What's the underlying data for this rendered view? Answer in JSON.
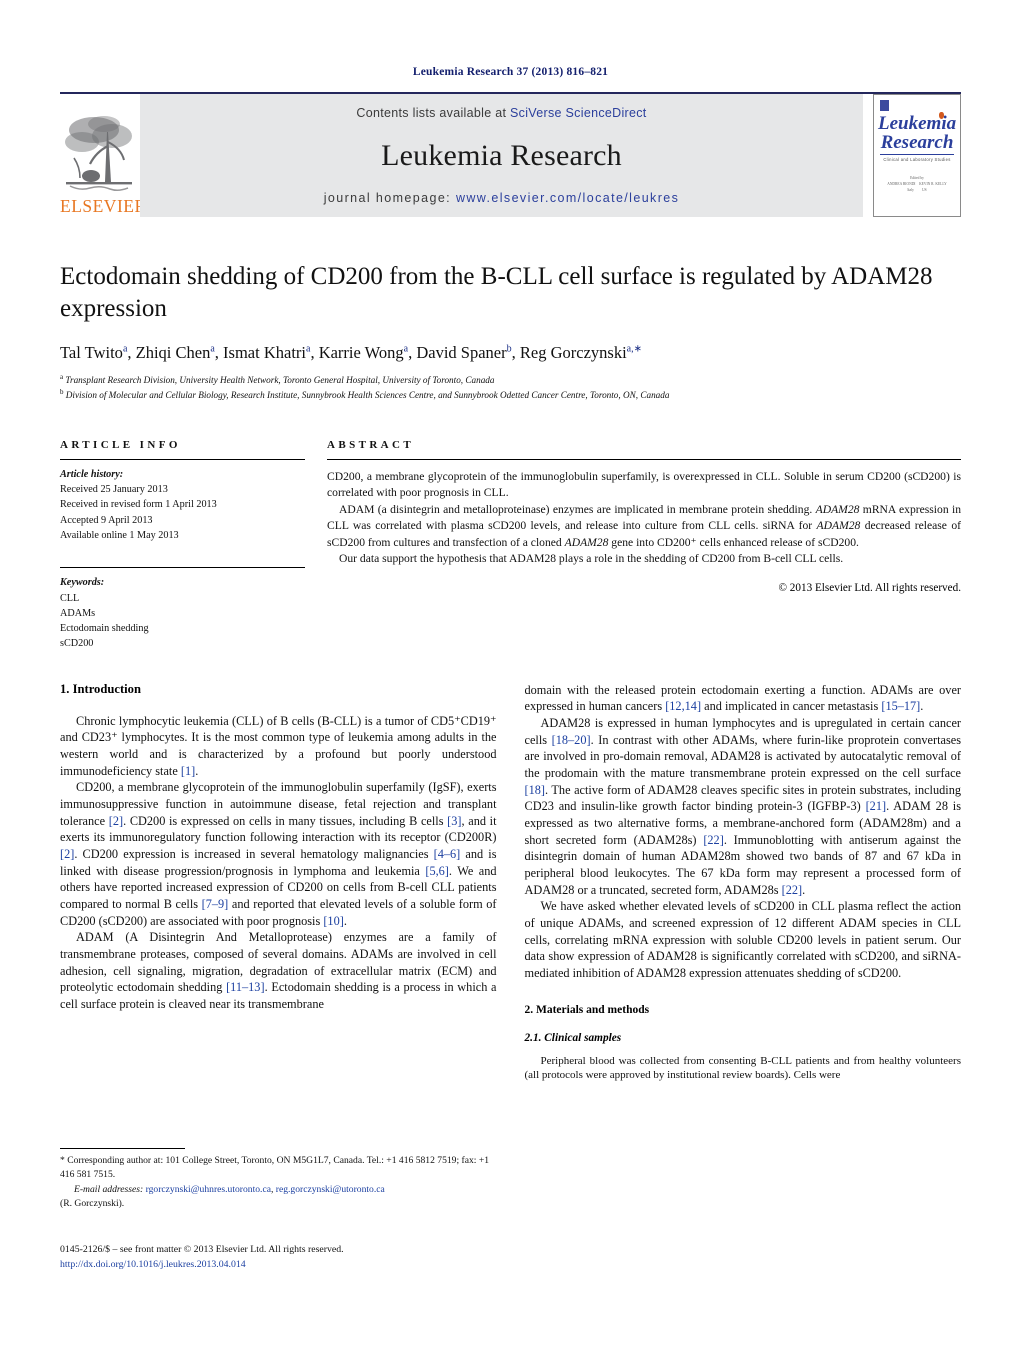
{
  "running_head": "Leukemia Research 37 (2013) 816–821",
  "masthead": {
    "publisher_name": "ELSEVIER",
    "contents_prefix": "Contents lists available at ",
    "contents_link": "SciVerse ScienceDirect",
    "journal_title": "Leukemia Research",
    "homepage_prefix": "journal homepage: ",
    "homepage_url": "www.elsevier.com/locate/leukres",
    "cover": {
      "line1": "Leukemia",
      "line2": "Research",
      "subtitle": "Clinical and Laboratory Studies"
    }
  },
  "article": {
    "title": "Ectodomain shedding of CD200 from the B-CLL cell surface is regulated by ADAM28 expression",
    "authors_html": "Tal Twito<sup>a</sup>, Zhiqi Chen<sup>a</sup>, Ismat Khatri<sup>a</sup>, Karrie Wong<sup>a</sup>, David Spaner<sup>b</sup>, Reg Gorczynski<sup>a,∗</sup>",
    "affiliation_a": "Transplant Research Division, University Health Network, Toronto General Hospital, University of Toronto, Canada",
    "affiliation_b": "Division of Molecular and Cellular Biology, Research Institute, Sunnybrook Health Sciences Centre, and Sunnybrook Odetted Cancer Centre, Toronto, ON, Canada"
  },
  "article_info": {
    "heading": "ARTICLE INFO",
    "history_label": "Article history:",
    "history": [
      "Received 25 January 2013",
      "Received in revised form 1 April 2013",
      "Accepted 9 April 2013",
      "Available online 1 May 2013"
    ],
    "keywords_label": "Keywords:",
    "keywords": [
      "CLL",
      "ADAMs",
      "Ectodomain shedding",
      "sCD200"
    ]
  },
  "abstract": {
    "heading": "ABSTRACT",
    "paragraphs": [
      "CD200, a membrane glycoprotein of the immunoglobulin superfamily, is overexpressed in CLL. Soluble in serum CD200 (sCD200) is correlated with poor prognosis in CLL.",
      "ADAM (a disintegrin and metalloproteinase) enzymes are implicated in membrane protein shedding. ADAM28 mRNA expression in CLL was correlated with plasma sCD200 levels, and release into culture from CLL cells. siRNA for ADAM28 decreased release of sCD200 from cultures and transfection of a cloned ADAM28 gene into CD200⁺ cells enhanced release of sCD200.",
      "Our data support the hypothesis that ADAM28 plays a role in the shedding of CD200 from B-cell CLL cells."
    ],
    "copyright": "© 2013 Elsevier Ltd. All rights reserved."
  },
  "sections": {
    "intro_heading": "1.  Introduction",
    "intro_paragraphs": [
      "Chronic lymphocytic leukemia (CLL) of B cells (B-CLL) is a tumor of CD5⁺CD19⁺ and CD23⁺ lymphocytes. It is the most common type of leukemia among adults in the western world and is characterized by a profound but poorly understood immunodeficiency state [1].",
      "CD200, a membrane glycoprotein of the immunoglobulin superfamily (IgSF), exerts immunosuppressive function in autoimmune disease, fetal rejection and transplant tolerance [2]. CD200 is expressed on cells in many tissues, including B cells [3], and it exerts its immunoregulatory function following interaction with its receptor (CD200R) [2]. CD200 expression is increased in several hematology malignancies [4–6] and is linked with disease progression/prognosis in lymphoma and leukemia [5,6]. We and others have reported increased expression of CD200 on cells from B-cell CLL patients compared to normal B cells [7–9] and reported that elevated levels of a soluble form of CD200 (sCD200) are associated with poor prognosis [10].",
      "ADAM (A Disintegrin And Metalloprotease) enzymes are a family of transmembrane proteases, composed of several domains. ADAMs are involved in cell adhesion, cell signaling, migration, degradation of extracellular matrix (ECM) and proteolytic ectodomain shedding [11–13]. Ectodomain shedding is a process in which a cell surface protein is cleaved near its transmembrane"
    ],
    "right_paragraphs": [
      "domain with the released protein ectodomain exerting a function. ADAMs are over expressed in human cancers [12,14] and implicated in cancer metastasis [15–17].",
      "ADAM28 is expressed in human lymphocytes and is upregulated in certain cancer cells [18–20]. In contrast with other ADAMs, where furin-like proprotein convertases are involved in pro-domain removal, ADAM28 is activated by autocatalytic removal of the prodomain with the mature transmembrane protein expressed on the cell surface [18]. The active form of ADAM28 cleaves specific sites in protein substrates, including CD23 and insulin-like growth factor binding protein-3 (IGFBP-3) [21]. ADAM 28 is expressed as two alternative forms, a membrane-anchored form (ADAM28m) and a short secreted form (ADAM28s) [22]. Immunoblotting with antiserum against the disintegrin domain of human ADAM28m showed two bands of 87 and 67 kDa in peripheral blood leukocytes. The 67 kDa form may represent a processed form of ADAM28 or a truncated, secreted form, ADAM28s [22].",
      "We have asked whether elevated levels of sCD200 in CLL plasma reflect the action of unique ADAMs, and screened expression of 12 different ADAM species in CLL cells, correlating mRNA expression with soluble CD200 levels in patient serum. Our data show expression of ADAM28 is significantly correlated with sCD200, and siRNA-mediated inhibition of ADAM28 expression attenuates shedding of sCD200."
    ],
    "methods_heading": "2.  Materials and methods",
    "methods_sub_heading": "2.1.  Clinical samples",
    "methods_paragraph": "Peripheral blood was collected from consenting B-CLL patients and from healthy volunteers (all protocols were approved by institutional review boards). Cells were"
  },
  "footnote": {
    "corresponding": "* Corresponding author at: 101 College Street, Toronto, ON M5G1L7, Canada. Tel.: +1 416 5812 7519; fax: +1 416 581 7515.",
    "email_label": "E-mail addresses:",
    "email1": "rgorczynski@uhnres.utoronto.ca",
    "email2": "reg.gorczynski@utoronto.ca",
    "email_owner": "(R. Gorczynski).",
    "issn_line": "0145-2126/$ – see front matter © 2013 Elsevier Ltd. All rights reserved.",
    "doi_line": "http://dx.doi.org/10.1016/j.leukres.2013.04.014"
  }
}
